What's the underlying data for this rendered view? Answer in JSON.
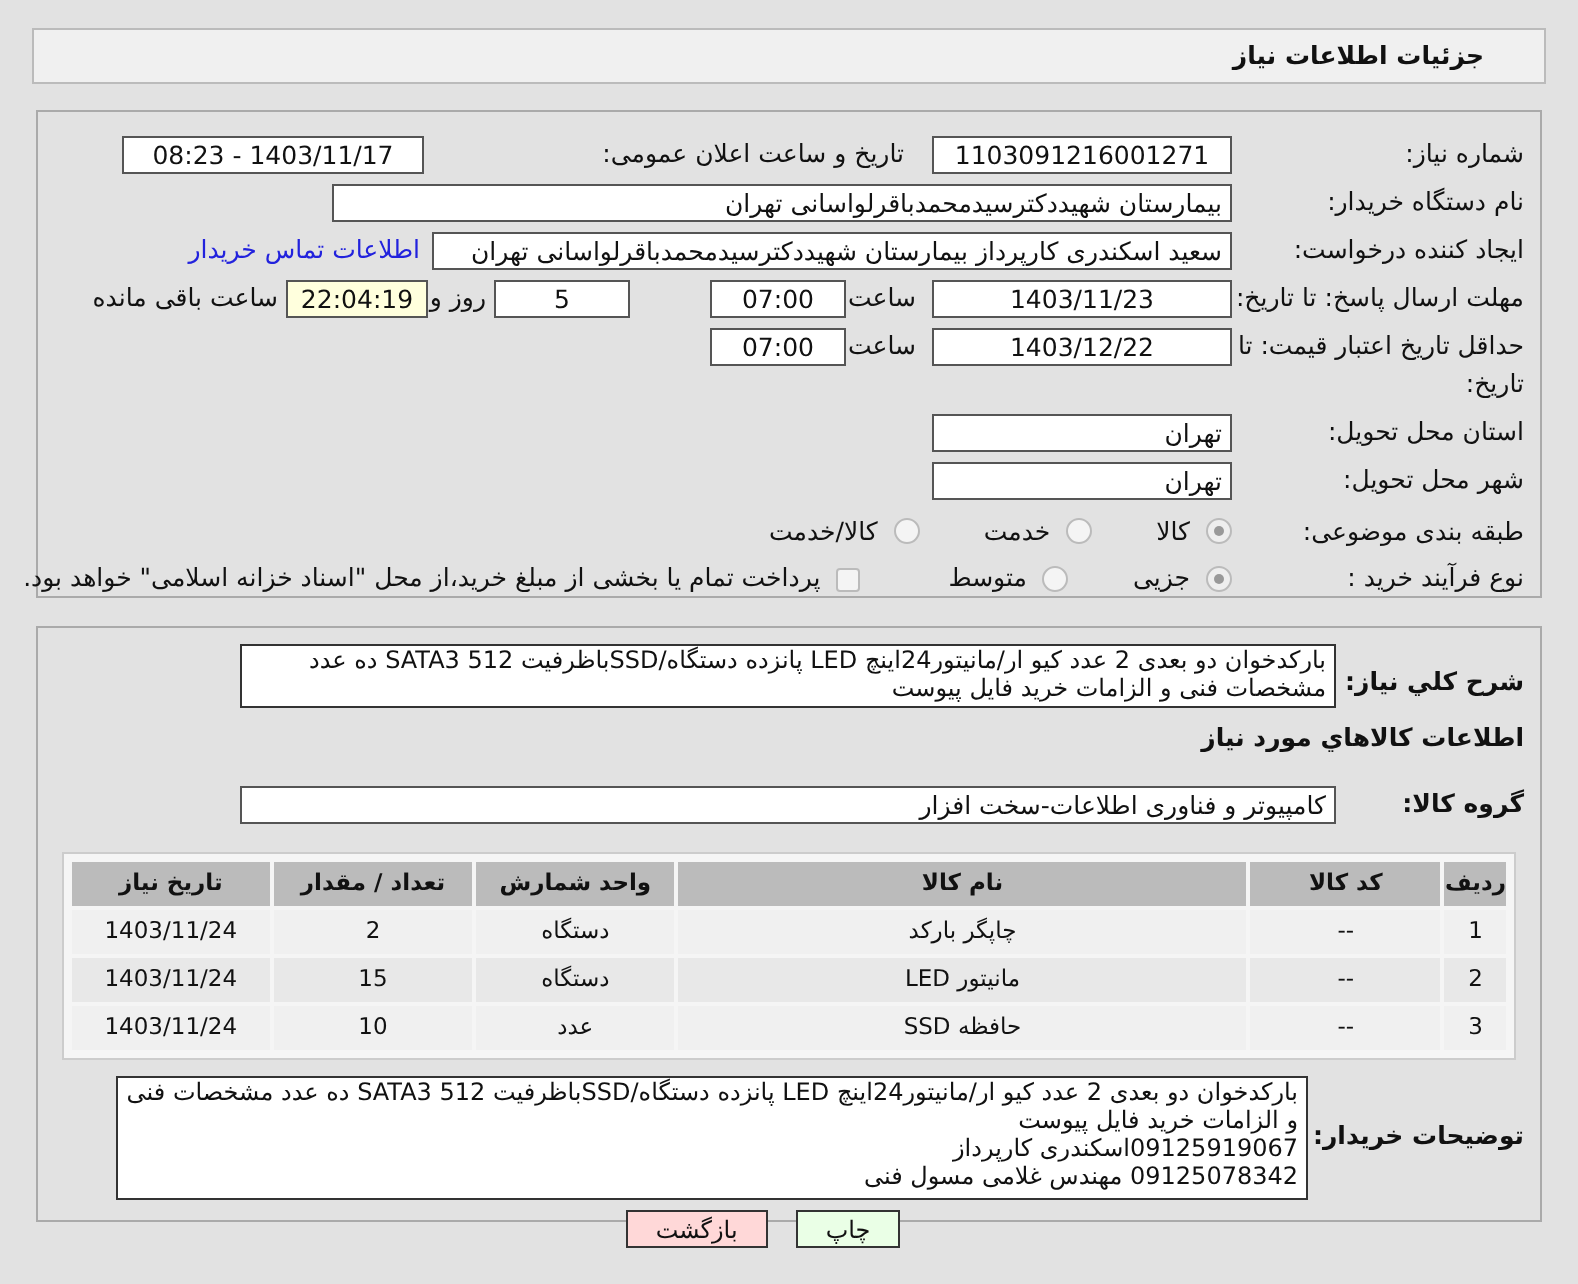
{
  "header": {
    "title": "جزئیات اطلاعات نیاز"
  },
  "fields": {
    "need_number": {
      "label": "شماره نیاز:",
      "value": "1103091216001271"
    },
    "announce": {
      "label": "تاریخ و ساعت اعلان عمومی:",
      "value": "1403/11/17 - 08:23"
    },
    "buyer_org": {
      "label": "نام دستگاه خریدار:",
      "value": "بیمارستان شهیددکترسیدمحمدباقرلواسانی تهران"
    },
    "creator": {
      "label": "ایجاد کننده درخواست:",
      "value": "سعید اسکندری کارپرداز بیمارستان شهیددکترسیدمحمدباقرلواسانی تهران",
      "link": "اطلاعات تماس خریدار"
    },
    "deadline": {
      "label": "مهلت ارسال پاسخ: تا تاریخ:",
      "date": "1403/11/23",
      "time_label": "ساعت",
      "time": "07:00",
      "days": "5",
      "days_label": "روز و",
      "remaining": "22:04:19",
      "remaining_label": "ساعت باقی مانده"
    },
    "validity": {
      "label": "حداقل تاریخ اعتبار قیمت: تا تاریخ:",
      "date": "1403/12/22",
      "time_label": "ساعت",
      "time": "07:00"
    },
    "province": {
      "label": "استان محل تحویل:",
      "value": "تهران"
    },
    "city": {
      "label": "شهر محل تحویل:",
      "value": "تهران"
    }
  },
  "category": {
    "label": "طبقه بندی موضوعی:",
    "options": [
      {
        "label": "کالا",
        "selected": true
      },
      {
        "label": "خدمت",
        "selected": false
      },
      {
        "label": "کالا/خدمت",
        "selected": false
      }
    ]
  },
  "purchase_type": {
    "label": "نوع فرآیند خرید :",
    "options": [
      {
        "label": "جزیی",
        "selected": true
      },
      {
        "label": "متوسط",
        "selected": false
      }
    ],
    "payment": {
      "label": "پرداخت تمام یا بخشی از مبلغ خرید،از محل \"اسناد خزانه اسلامی\" خواهد بود.",
      "checked": false
    }
  },
  "description": {
    "label": "شرح کلي نياز:",
    "value": "بارکدخوان دو بعدی 2 عدد کیو ار/مانیتور24اینچ LED پانزده دستگاه/SSDباظرفیت SATA3 512 ده عدد مشخصات فنی و الزامات خرید فایل پیوست"
  },
  "goods_title": "اطلاعات کالاهاي مورد نياز",
  "goods_group": {
    "label": "گروه کالا:",
    "value": "کامپیوتر و فناوری اطلاعات-سخت افزار"
  },
  "table": {
    "columns": [
      "ردیف",
      "کد کالا",
      "نام کالا",
      "واحد شمارش",
      "تعداد / مقدار",
      "تاریخ نیاز"
    ],
    "rows": [
      [
        "1",
        "--",
        "چاپگر بارکد",
        "دستگاه",
        "2",
        "1403/11/24"
      ],
      [
        "2",
        "--",
        "مانیتور LED",
        "دستگاه",
        "15",
        "1403/11/24"
      ],
      [
        "3",
        "--",
        "حافظه SSD",
        "عدد",
        "10",
        "1403/11/24"
      ]
    ]
  },
  "buyer_notes": {
    "label": "توضیحات خریدار:",
    "lines": [
      "بارکدخوان دو بعدی 2 عدد کیو ار/مانیتور24اینچ LED پانزده دستگاه/SSDباظرفیت SATA3 512 ده عدد مشخصات فنی و الزامات خرید فایل پیوست",
      "09125919067اسکندری کارپرداز",
      "09125078342 مهندس غلامی مسول فنی"
    ]
  },
  "buttons": [
    {
      "label": "چاپ",
      "kind": "print"
    },
    {
      "label": "بازگشت",
      "kind": "back"
    }
  ]
}
